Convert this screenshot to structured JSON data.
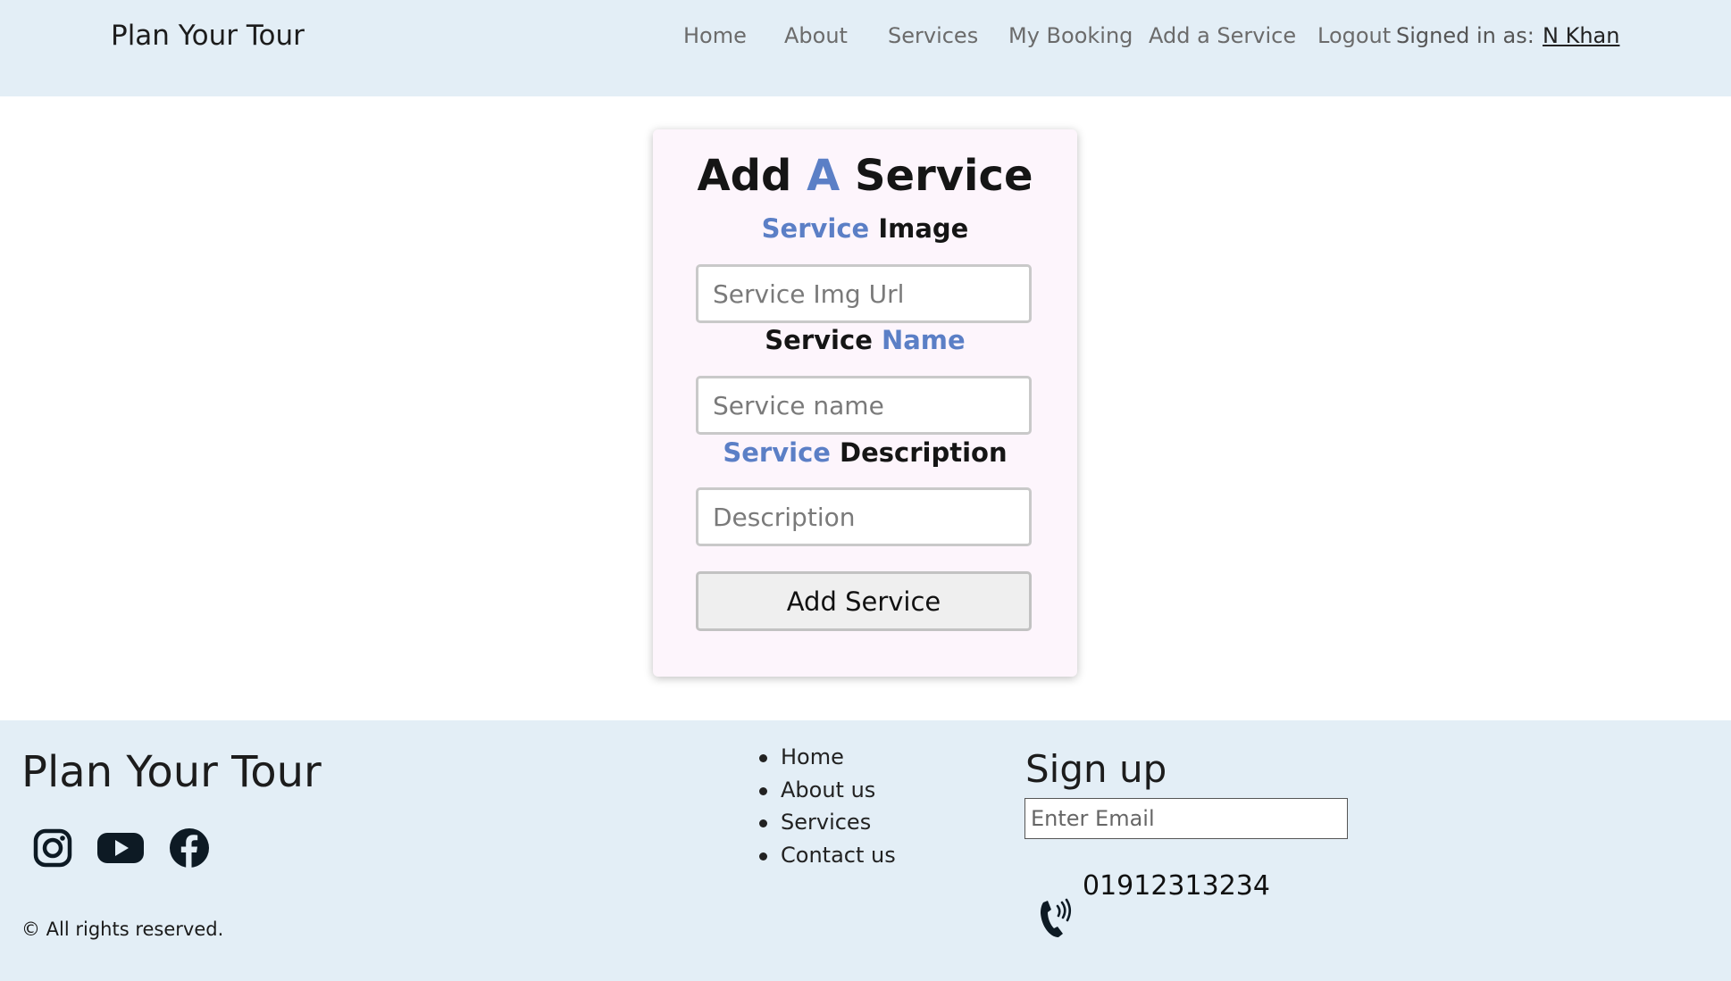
{
  "header": {
    "brand": "Plan Your Tour",
    "nav": {
      "home": "Home",
      "about": "About",
      "services": "Services",
      "my_booking": "My Booking",
      "add_service": "Add a Service",
      "logout": "Logout",
      "signed_in_label": "Signed in as:",
      "user_name": "N Khan"
    }
  },
  "form": {
    "title_part1": "Add",
    "title_accent": "A",
    "title_part2": "Service",
    "image_label_accent": "Service",
    "image_label_rest": "Image",
    "image_placeholder": "Service Img Url",
    "name_label_part1": "Service",
    "name_label_accent": "Name",
    "name_placeholder": "Service name",
    "desc_label_accent": "Service",
    "desc_label_rest": "Description",
    "desc_placeholder": "Description",
    "submit_label": "Add Service",
    "accent_color": "#5b7fc6"
  },
  "footer": {
    "brand": "Plan Your Tour",
    "social_icons": [
      "instagram-icon",
      "youtube-icon",
      "facebook-icon"
    ],
    "rights": "© All rights reserved.",
    "links": [
      "Home",
      "About us",
      "Services",
      "Contact us"
    ],
    "signup_title": "Sign up",
    "email_placeholder": "Enter Email",
    "phone": "01912313234"
  }
}
